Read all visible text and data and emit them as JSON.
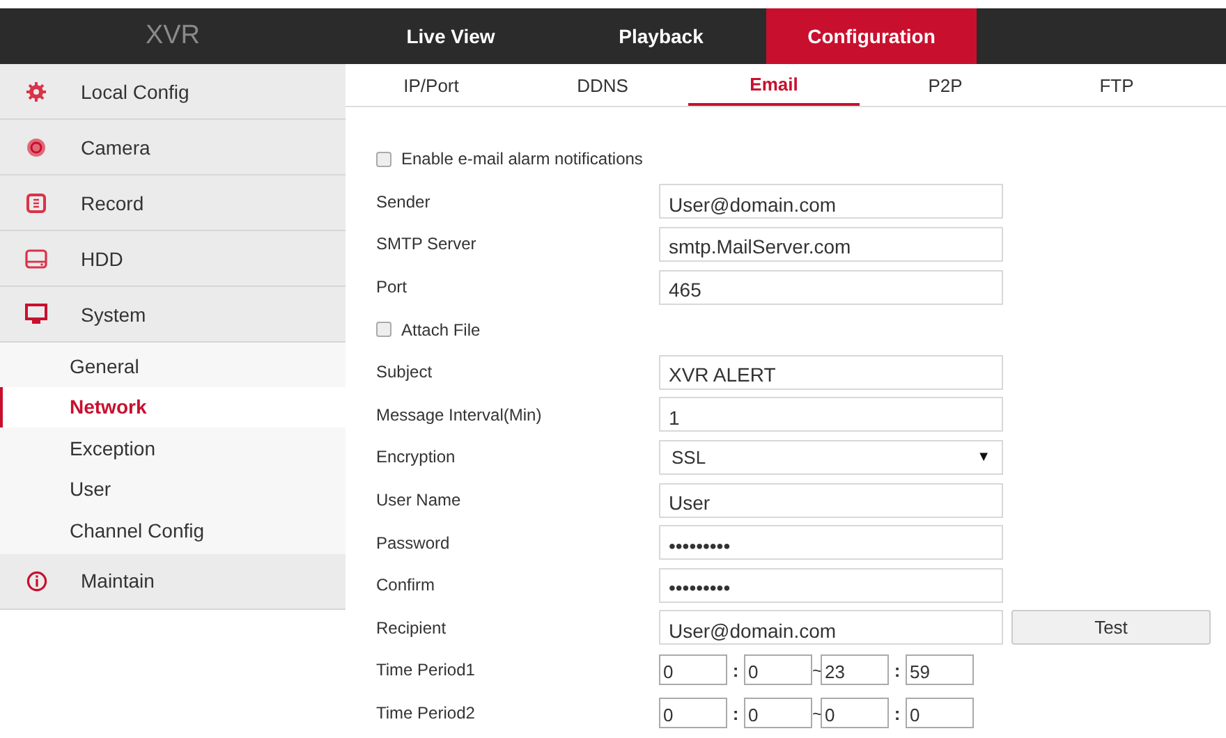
{
  "header": {
    "logo": "XVR",
    "tabs": [
      {
        "label": "Live View",
        "selected": false
      },
      {
        "label": "Playback",
        "selected": false
      },
      {
        "label": "Configuration",
        "selected": true
      }
    ]
  },
  "sidebar": {
    "items": [
      {
        "label": "Local Config"
      },
      {
        "label": "Camera"
      },
      {
        "label": "Record"
      },
      {
        "label": "HDD"
      },
      {
        "label": "System",
        "children": [
          {
            "label": "General",
            "selected": false
          },
          {
            "label": "Network",
            "selected": true
          },
          {
            "label": "Exception",
            "selected": false
          },
          {
            "label": "User",
            "selected": false
          },
          {
            "label": "Channel Config",
            "selected": false
          }
        ]
      },
      {
        "label": "Maintain"
      }
    ]
  },
  "subtabs": [
    {
      "label": "IP/Port",
      "selected": false
    },
    {
      "label": "DDNS",
      "selected": false
    },
    {
      "label": "Email",
      "selected": true
    },
    {
      "label": "P2P",
      "selected": false
    },
    {
      "label": "FTP",
      "selected": false
    }
  ],
  "form": {
    "rows": [
      {
        "kind": "checkbox",
        "label": "Enable e-mail alarm notifications",
        "checked": false
      },
      {
        "kind": "text",
        "label": "Sender",
        "value": "User@domain.com"
      },
      {
        "kind": "text",
        "label": "SMTP Server",
        "value": "smtp.MailServer.com"
      },
      {
        "kind": "text",
        "label": "Port",
        "value": "465"
      },
      {
        "kind": "checkbox",
        "label": "Attach File",
        "checked": false
      },
      {
        "kind": "text",
        "label": "Subject",
        "value": "XVR ALERT"
      },
      {
        "kind": "text",
        "label": "Message Interval(Min)",
        "value": "1"
      },
      {
        "kind": "select",
        "label": "Encryption",
        "value": "SSL",
        "arrow": "▼"
      },
      {
        "kind": "text",
        "label": "User Name",
        "value": "User"
      },
      {
        "kind": "text",
        "label": "Password",
        "value": "•••••••••"
      },
      {
        "kind": "text",
        "label": "Confirm",
        "value": "•••••••••"
      },
      {
        "kind": "button",
        "label": "Recipient",
        "value": "User@domain.com",
        "button": "Test"
      },
      {
        "kind": "time",
        "label": "Time Period1",
        "values": [
          "0",
          "0",
          "23",
          "59"
        ],
        "separators": [
          ":",
          "~",
          ":"
        ]
      },
      {
        "kind": "time",
        "label": "Time Period2",
        "values": [
          "0",
          "0",
          "0",
          "0"
        ],
        "separators": [
          ":",
          "~",
          ":"
        ]
      }
    ]
  }
}
